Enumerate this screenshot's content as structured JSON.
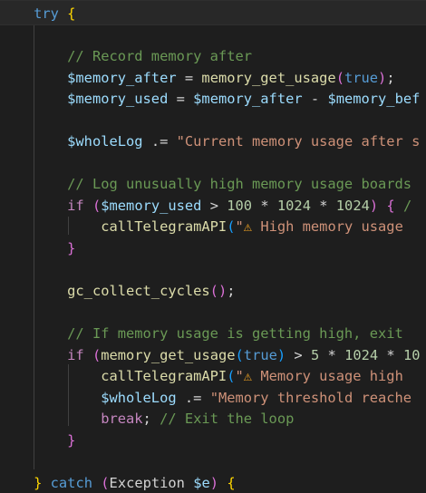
{
  "colors": {
    "background": "#1e1e1e",
    "current_line": "#282828",
    "indent_guide": "#404040"
  },
  "code_lines": [
    {
      "indent": "    ",
      "tokens": [
        {
          "text": "try",
          "kind": "keyword"
        },
        {
          "text": " ",
          "kind": "plain"
        },
        {
          "text": "{",
          "kind": "bracket1"
        }
      ]
    },
    {
      "indent": "",
      "tokens": []
    },
    {
      "indent": "        ",
      "tokens": [
        {
          "text": "// Record memory after",
          "kind": "comment"
        }
      ]
    },
    {
      "indent": "        ",
      "tokens": [
        {
          "text": "$memory_after",
          "kind": "var"
        },
        {
          "text": " = ",
          "kind": "plain"
        },
        {
          "text": "memory_get_usage",
          "kind": "func"
        },
        {
          "text": "(",
          "kind": "bracket2"
        },
        {
          "text": "true",
          "kind": "keyword"
        },
        {
          "text": ")",
          "kind": "bracket2"
        },
        {
          "text": ";",
          "kind": "plain"
        }
      ]
    },
    {
      "indent": "        ",
      "tokens": [
        {
          "text": "$memory_used",
          "kind": "var"
        },
        {
          "text": " = ",
          "kind": "plain"
        },
        {
          "text": "$memory_after",
          "kind": "var"
        },
        {
          "text": " - ",
          "kind": "plain"
        },
        {
          "text": "$memory_bef",
          "kind": "var"
        }
      ]
    },
    {
      "indent": "",
      "tokens": []
    },
    {
      "indent": "        ",
      "tokens": [
        {
          "text": "$wholeLog",
          "kind": "var"
        },
        {
          "text": " .= ",
          "kind": "plain"
        },
        {
          "text": "\"Current memory usage after s",
          "kind": "string"
        }
      ]
    },
    {
      "indent": "",
      "tokens": []
    },
    {
      "indent": "        ",
      "tokens": [
        {
          "text": "// Log unusually high memory usage boards",
          "kind": "comment"
        }
      ]
    },
    {
      "indent": "        ",
      "tokens": [
        {
          "text": "if",
          "kind": "control"
        },
        {
          "text": " ",
          "kind": "plain"
        },
        {
          "text": "(",
          "kind": "bracket2"
        },
        {
          "text": "$memory_used",
          "kind": "var"
        },
        {
          "text": " > ",
          "kind": "plain"
        },
        {
          "text": "100",
          "kind": "number"
        },
        {
          "text": " * ",
          "kind": "plain"
        },
        {
          "text": "1024",
          "kind": "number"
        },
        {
          "text": " * ",
          "kind": "plain"
        },
        {
          "text": "1024",
          "kind": "number"
        },
        {
          "text": ")",
          "kind": "bracket2"
        },
        {
          "text": " ",
          "kind": "plain"
        },
        {
          "text": "{",
          "kind": "bracket2"
        },
        {
          "text": " /",
          "kind": "comment"
        }
      ]
    },
    {
      "indent": "            ",
      "tokens": [
        {
          "text": "callTelegramAPI",
          "kind": "func"
        },
        {
          "text": "(",
          "kind": "bracket3"
        },
        {
          "text": "\"",
          "kind": "string"
        },
        {
          "text": "⚠",
          "kind": "emoji"
        },
        {
          "text": " High memory usage",
          "kind": "string"
        }
      ]
    },
    {
      "indent": "        ",
      "tokens": [
        {
          "text": "}",
          "kind": "bracket2"
        }
      ]
    },
    {
      "indent": "",
      "tokens": []
    },
    {
      "indent": "        ",
      "tokens": [
        {
          "text": "gc_collect_cycles",
          "kind": "func"
        },
        {
          "text": "()",
          "kind": "bracket2"
        },
        {
          "text": ";",
          "kind": "plain"
        }
      ]
    },
    {
      "indent": "",
      "tokens": []
    },
    {
      "indent": "        ",
      "tokens": [
        {
          "text": "// If memory usage is getting high, exit",
          "kind": "comment"
        }
      ]
    },
    {
      "indent": "        ",
      "tokens": [
        {
          "text": "if",
          "kind": "control"
        },
        {
          "text": " ",
          "kind": "plain"
        },
        {
          "text": "(",
          "kind": "bracket2"
        },
        {
          "text": "memory_get_usage",
          "kind": "func"
        },
        {
          "text": "(",
          "kind": "bracket3"
        },
        {
          "text": "true",
          "kind": "keyword"
        },
        {
          "text": ")",
          "kind": "bracket3"
        },
        {
          "text": " > ",
          "kind": "plain"
        },
        {
          "text": "5",
          "kind": "number"
        },
        {
          "text": " * ",
          "kind": "plain"
        },
        {
          "text": "1024",
          "kind": "number"
        },
        {
          "text": " * ",
          "kind": "plain"
        },
        {
          "text": "10",
          "kind": "number"
        }
      ]
    },
    {
      "indent": "            ",
      "tokens": [
        {
          "text": "callTelegramAPI",
          "kind": "func"
        },
        {
          "text": "(",
          "kind": "bracket3"
        },
        {
          "text": "\"",
          "kind": "string"
        },
        {
          "text": "⚠",
          "kind": "emoji"
        },
        {
          "text": " Memory usage high",
          "kind": "string"
        }
      ]
    },
    {
      "indent": "            ",
      "tokens": [
        {
          "text": "$wholeLog",
          "kind": "var"
        },
        {
          "text": " .= ",
          "kind": "plain"
        },
        {
          "text": "\"Memory threshold reache",
          "kind": "string"
        }
      ]
    },
    {
      "indent": "            ",
      "tokens": [
        {
          "text": "break",
          "kind": "control"
        },
        {
          "text": "; ",
          "kind": "plain"
        },
        {
          "text": "// Exit the loop",
          "kind": "comment"
        }
      ]
    },
    {
      "indent": "        ",
      "tokens": [
        {
          "text": "}",
          "kind": "bracket2"
        }
      ]
    },
    {
      "indent": "",
      "tokens": []
    },
    {
      "indent": "    ",
      "tokens": [
        {
          "text": "}",
          "kind": "bracket1"
        },
        {
          "text": " ",
          "kind": "plain"
        },
        {
          "text": "catch",
          "kind": "keyword"
        },
        {
          "text": " ",
          "kind": "plain"
        },
        {
          "text": "(",
          "kind": "bracket2"
        },
        {
          "text": "Exception",
          "kind": "plain"
        },
        {
          "text": " ",
          "kind": "plain"
        },
        {
          "text": "$e",
          "kind": "var"
        },
        {
          "text": ")",
          "kind": "bracket2"
        },
        {
          "text": " ",
          "kind": "plain"
        },
        {
          "text": "{",
          "kind": "bracket1"
        }
      ]
    }
  ]
}
